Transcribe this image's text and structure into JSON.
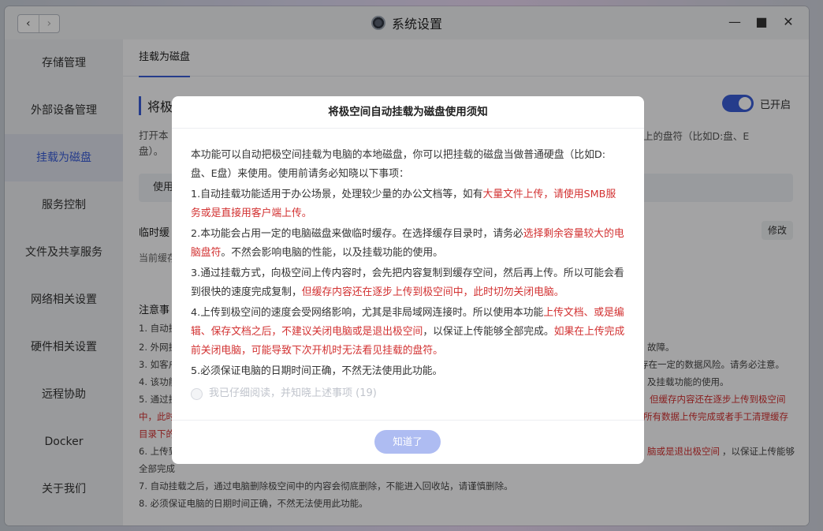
{
  "window": {
    "title": "系统设置",
    "back": "‹",
    "forward": "›",
    "minimize": "—",
    "maximize": "■",
    "close": "✕"
  },
  "sidebar": {
    "items": [
      {
        "label": "存储管理"
      },
      {
        "label": "外部设备管理"
      },
      {
        "label": "挂载为磁盘"
      },
      {
        "label": "服务控制"
      },
      {
        "label": "文件及共享服务"
      },
      {
        "label": "网络相关设置"
      },
      {
        "label": "硬件相关设置"
      },
      {
        "label": "远程协助"
      },
      {
        "label": "Docker"
      },
      {
        "label": "关于我们"
      }
    ],
    "active_index": 2
  },
  "main": {
    "tab": "挂载为磁盘",
    "section_title": "将极空间自动挂载为磁盘",
    "toggle_label": "已开启",
    "desc_line1": "打开本",
    "desc_right": "上的盘符（比如D:盘、E",
    "desc_line2": "盘）。",
    "use_bar": "使用",
    "cache_title": "临时缓",
    "modify_button": "修改",
    "cache_desc": "当前缓存",
    "notes_title": "注意事",
    "notes": [
      {
        "text": "1. 自动挂",
        "red": false
      },
      {
        "text": "2. 外网挂",
        "red": false
      },
      {
        "text": "3. 如客户",
        "red": false
      },
      {
        "text": "4. 该功能",
        "red": false
      },
      {
        "text": "5. 通过挂",
        "red": false
      },
      {
        "text": "中，此时",
        "red": true
      },
      {
        "text": "目录下的",
        "red": true
      },
      {
        "text": "6. 上传到",
        "red": false
      },
      {
        "text": "全部完成",
        "red": false
      },
      {
        "text": "7. 自动挂载之后，通过电脑删除极空间中的内容会彻底删除，不能进入回收站，请谨慎删除。",
        "red": false
      },
      {
        "text": "8. 必须保证电脑的日期时间正确，不然无法使用此功能。",
        "red": false
      }
    ],
    "notes_right": [
      {
        "text": "故障。",
        "red": false
      },
      {
        "text": "存在一定的数据风险。请务必注意。",
        "red": false
      },
      {
        "text": "及挂载功能的使用。",
        "red": false
      },
      {
        "text": "但缓存内容还在逐步上传到极空间",
        "red": true
      },
      {
        "text": "所有数据上传完成或者手工清理缓存",
        "red": true
      },
      {
        "text": "脑或是退出极空间",
        "red": true
      },
      {
        "text": "，以保证上传能够",
        "red": false
      }
    ]
  },
  "modal": {
    "title": "将极空间自动挂载为磁盘使用须知",
    "intro": "本功能可以自动把极空间挂载为电脑的本地磁盘，你可以把挂载的磁盘当做普通硬盘（比如D:盘、E盘）来使用。使用前请务必知晓以下事项：",
    "item1_a": "1.自动挂载功能适用于办公场景，处理较少量的办公文档等，如有",
    "item1_b": "大量文件上传，请使用SMB服务或是直接用客户端上传。",
    "item2_a": "2.本功能会占用一定的电脑磁盘来做临时缓存。在选择缓存目录时，请务必",
    "item2_b": "选择剩余容量较大的电脑盘符",
    "item2_c": "。不然会影响电脑的性能，以及挂载功能的使用。",
    "item3_a": "3.通过挂载方式，向极空间上传内容时，会先把内容复制到缓存空间，然后再上传。所以可能会看到很快的速度完成复制，",
    "item3_b": "但缓存内容还在逐步上传到极空间中，此时切勿关闭电脑。",
    "item4_a": "4.上传到极空间的速度会受网络影响，尤其是非局域网连接时。所以使用本功能",
    "item4_b": "上传文档、或是编辑、保存文档之后，不建议关闭电脑或是退出极空间",
    "item4_c": "，以保证上传能够全部完成。",
    "item4_d": "如果在上传完成前关闭电脑，可能导致下次开机时无法看见挂载的盘符。",
    "item5": "5.必须保证电脑的日期时间正确，不然无法使用此功能。",
    "checkbox_label": "我已仔细阅读，并知晓上述事项 (19)",
    "ok_button": "知道了"
  },
  "colors": {
    "accent": "#3a5cd6",
    "warning_red": "#d23030",
    "ok_disabled": "#aebcf2"
  }
}
